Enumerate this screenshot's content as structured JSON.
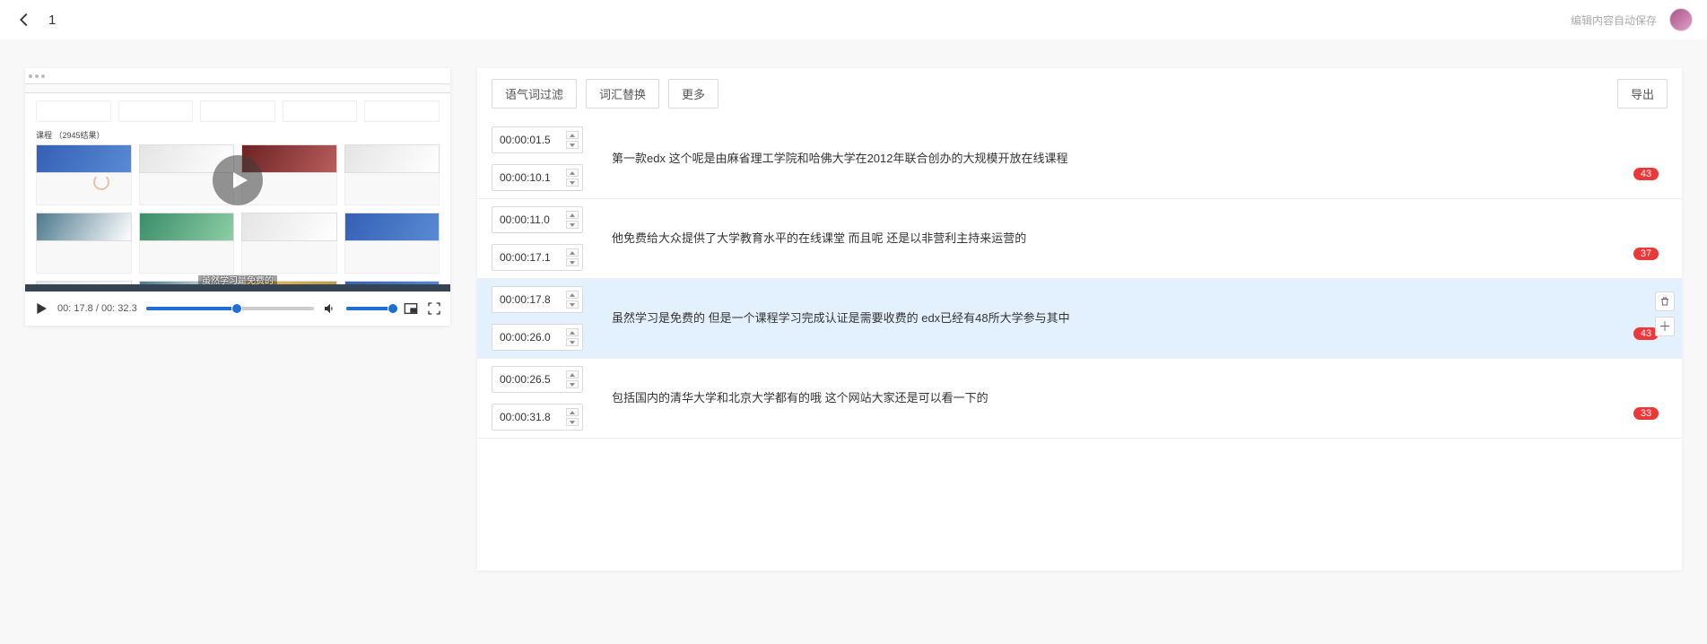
{
  "header": {
    "title": "1",
    "autosave": "编辑内容自动保存"
  },
  "video": {
    "grid_label": "课程 （2945结果）",
    "caption": "虽然学习是免费的"
  },
  "player": {
    "current": "00: 17.8",
    "total": "00: 32.3",
    "progress_pct": 54,
    "volume_pct": 96
  },
  "toolbar": {
    "filter": "语气词过滤",
    "replace": "词汇替换",
    "more": "更多",
    "export": "导出"
  },
  "rows": [
    {
      "t1": "00:00:01.5",
      "t2": "00:00:10.1",
      "text": "第一款edx 这个呢是由麻省理工学院和哈佛大学在2012年联合创办的大规模开放在线课程",
      "badge": "43",
      "active": false
    },
    {
      "t1": "00:00:11.0",
      "t2": "00:00:17.1",
      "text": "他免费给大众提供了大学教育水平的在线课堂 而且呢 还是以非营利主持来运营的",
      "badge": "37",
      "active": false
    },
    {
      "t1": "00:00:17.8",
      "t2": "00:00:26.0",
      "text": "虽然学习是免费的 但是一个课程学习完成认证是需要收费的 edx已经有48所大学参与其中",
      "badge": "43",
      "active": true
    },
    {
      "t1": "00:00:26.5",
      "t2": "00:00:31.8",
      "text": "包括国内的清华大学和北京大学都有的哦 这个网站大家还是可以看一下的",
      "badge": "33",
      "active": false
    }
  ]
}
